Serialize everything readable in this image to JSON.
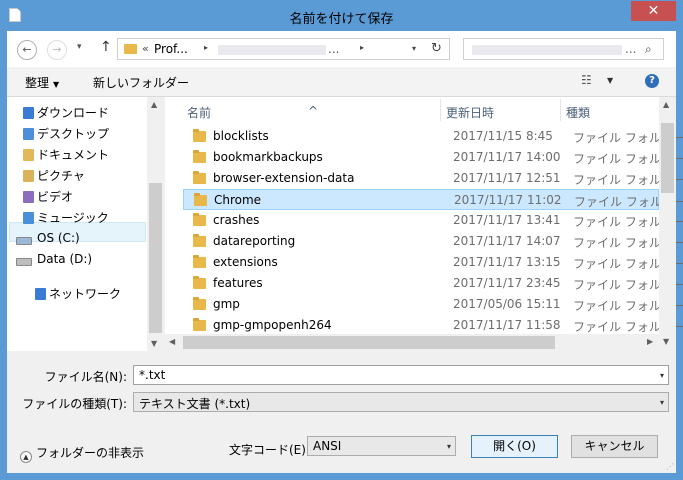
{
  "window": {
    "title": "名前を付けて保存",
    "close_label": "✕"
  },
  "navbar": {
    "back_icon": "←",
    "forward_icon": "→",
    "dropdown_icon": "▾",
    "up_icon": "↑",
    "address": {
      "prefix": "«",
      "segment": "Prof...",
      "chevron": "▸",
      "ellipsis": "...",
      "refresh_icon": "↻"
    },
    "search": {
      "ellipsis": "...",
      "icon": "⌕"
    }
  },
  "toolbar": {
    "organize": "整理",
    "organize_caret": "▼",
    "new_folder": "新しいフォルダー",
    "view_icon": "☷",
    "view_caret": "▼",
    "help": "?"
  },
  "nav_pane": {
    "items": [
      {
        "label": "ダウンロード",
        "color": "#3a7bd5"
      },
      {
        "label": "デスクトップ",
        "color": "#4f8ed9"
      },
      {
        "label": "ドキュメント",
        "color": "#e1b85a"
      },
      {
        "label": "ピクチャ",
        "color": "#d9b25a"
      },
      {
        "label": "ビデオ",
        "color": "#8a6dbf"
      },
      {
        "label": "ミュージック",
        "color": "#4a90d9"
      },
      {
        "label": "OS (C:)",
        "color": "#9cb8d8"
      },
      {
        "label": "Data (D:)",
        "color": "#bdbdbd"
      },
      {
        "label": "ネットワーク",
        "color": "#3a7bd5"
      }
    ],
    "scroll_up": "▲",
    "scroll_down": "▼"
  },
  "file_list": {
    "columns": {
      "name": "名前",
      "date": "更新日時",
      "type": "種類"
    },
    "sort_caret": "^",
    "rows": [
      {
        "name": "blocklists",
        "date": "2017/11/15 8:45",
        "type": "ファイル フォルダー"
      },
      {
        "name": "bookmarkbackups",
        "date": "2017/11/17 14:00",
        "type": "ファイル フォルダー"
      },
      {
        "name": "browser-extension-data",
        "date": "2017/11/17 12:51",
        "type": "ファイル フォルダー"
      },
      {
        "name": "Chrome",
        "date": "2017/11/17 11:02",
        "type": "ファイル フォルダー"
      },
      {
        "name": "crashes",
        "date": "2017/11/17 13:41",
        "type": "ファイル フォルダー"
      },
      {
        "name": "datareporting",
        "date": "2017/11/17 14:07",
        "type": "ファイル フォルダー"
      },
      {
        "name": "extensions",
        "date": "2017/11/17 13:15",
        "type": "ファイル フォルダー"
      },
      {
        "name": "features",
        "date": "2017/11/17 23:45",
        "type": "ファイル フォルダー"
      },
      {
        "name": "gmp",
        "date": "2017/05/06 15:11",
        "type": "ファイル フォルダー"
      },
      {
        "name": "gmp-gmpopenh264",
        "date": "2017/11/17 11:58",
        "type": "ファイル フォルダー"
      }
    ],
    "selected_index": 3,
    "scroll_up": "▲",
    "scroll_down": "▼",
    "scroll_left": "◀",
    "scroll_right": "▶"
  },
  "form": {
    "filename_label": "ファイル名(N):",
    "filename_value": "*.txt",
    "filetype_label": "ファイルの種類(T):",
    "filetype_value": "テキスト文書 (*.txt)",
    "encoding_label": "文字コード(E):",
    "encoding_value": "ANSI",
    "dd_icon": "▾"
  },
  "footer": {
    "hide_folders_icon": "▲",
    "hide_folders": "フォルダーの非表示",
    "open_button": "開く(O)",
    "cancel_button": "キャンセル",
    "grip": "⋰"
  }
}
